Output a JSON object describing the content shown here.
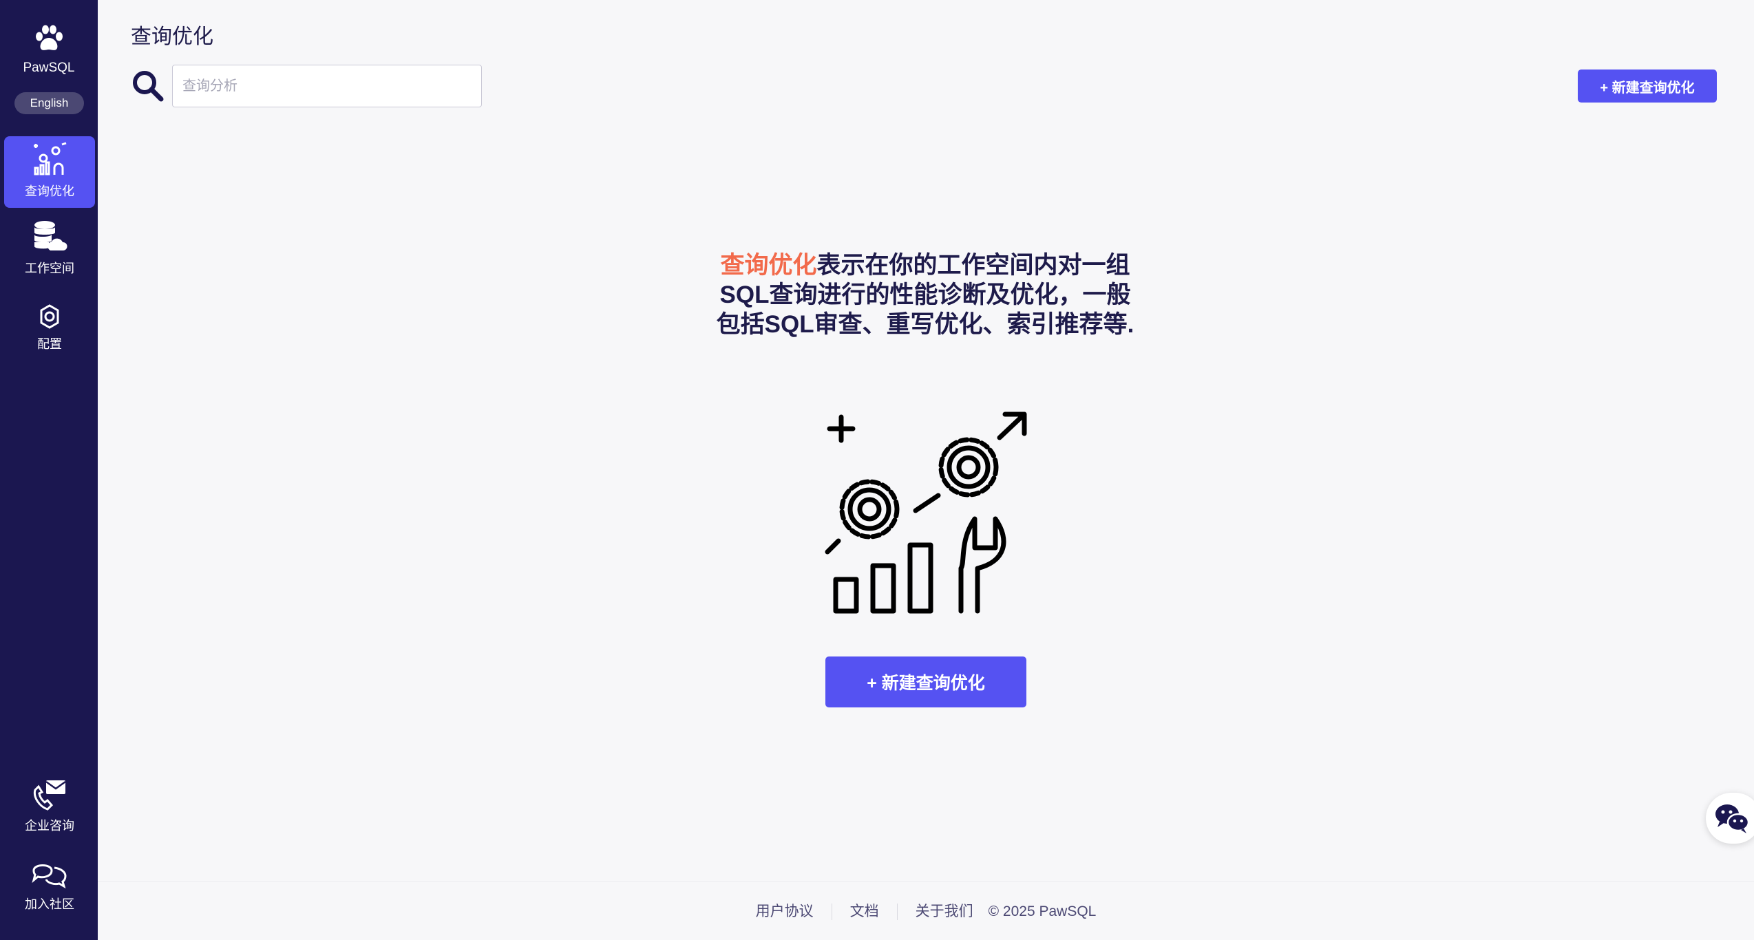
{
  "app": {
    "logo_text": "PawSQL",
    "language_button": "English"
  },
  "sidebar": {
    "nav": [
      {
        "label": "查询优化",
        "active": true
      },
      {
        "label": "工作空间",
        "active": false
      },
      {
        "label": "配置",
        "active": false
      }
    ],
    "bottom": [
      {
        "label": "企业咨询"
      },
      {
        "label": "加入社区"
      }
    ]
  },
  "header": {
    "title": "查询优化",
    "search_placeholder": "查询分析",
    "new_button": "+ 新建查询优化"
  },
  "empty_state": {
    "highlight": "查询优化",
    "description": "表示在你的工作空间内对一组SQL查询进行的性能诊断及优化，一般包括SQL审查、重写优化、索引推荐等.",
    "button": "+ 新建查询优化"
  },
  "footer": {
    "links": [
      "用户协议",
      "文档",
      "关于我们"
    ],
    "copyright": "© 2025 PawSQL"
  },
  "colors": {
    "sidebar": "#1b1750",
    "accent": "#5552f2",
    "highlight": "#f26a4b",
    "background": "#f7f7f9"
  },
  "icons": {
    "logo": "paw-icon",
    "search": "search-icon",
    "illustration": "optimization-illustration",
    "chat": "wechat-icon"
  }
}
